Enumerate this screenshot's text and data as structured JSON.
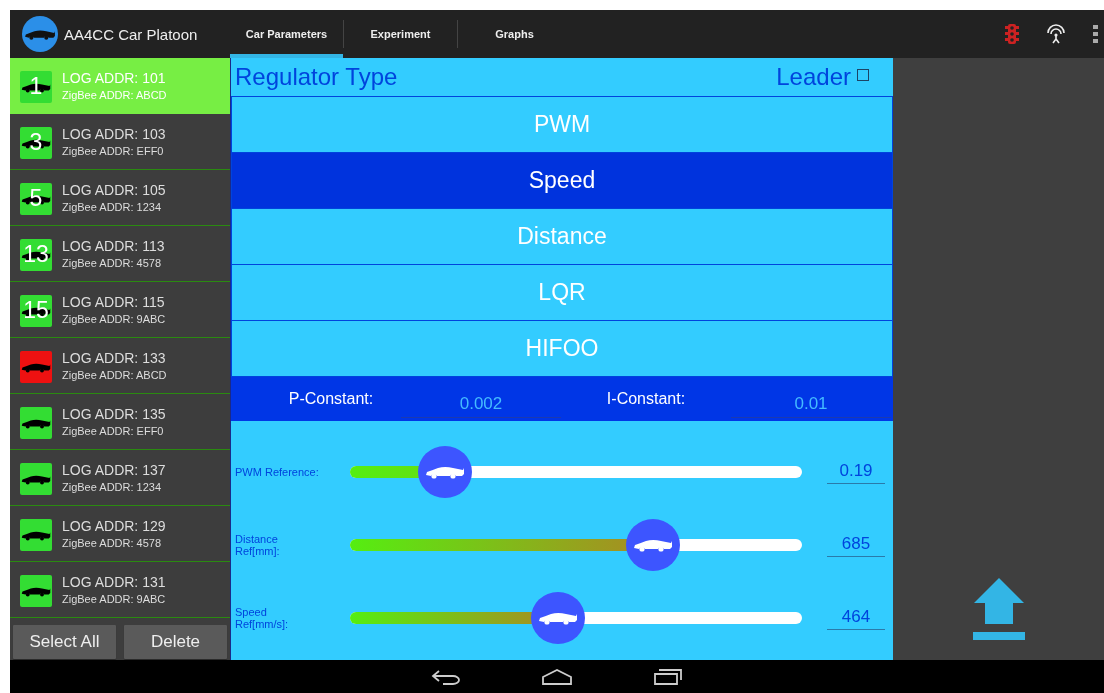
{
  "app_bar": {
    "title": "AA4CC Car Platoon",
    "tabs": [
      {
        "label": "Car Parameters",
        "selected": true
      },
      {
        "label": "Experiment",
        "selected": false
      },
      {
        "label": "Graphs",
        "selected": false
      }
    ]
  },
  "cars": [
    {
      "number": "1",
      "log_addr": "LOG ADDR: 101",
      "zigbee_addr": "ZigBee ADDR: ABCD",
      "color": "#33dd33",
      "selected": true
    },
    {
      "number": "3",
      "log_addr": "LOG ADDR: 103",
      "zigbee_addr": "ZigBee ADDR: EFF0",
      "color": "#33dd33",
      "selected": false
    },
    {
      "number": "5",
      "log_addr": "LOG ADDR: 105",
      "zigbee_addr": "ZigBee ADDR: 1234",
      "color": "#33dd33",
      "selected": false
    },
    {
      "number": "13",
      "log_addr": "LOG ADDR: 113",
      "zigbee_addr": "ZigBee ADDR: 4578",
      "color": "#33dd33",
      "selected": false
    },
    {
      "number": "15",
      "log_addr": "LOG ADDR: 115",
      "zigbee_addr": "ZigBee ADDR: 9ABC",
      "color": "#33dd33",
      "selected": false
    },
    {
      "log_addr": "LOG ADDR: 133",
      "zigbee_addr": "ZigBee ADDR: ABCD",
      "color": "#ee1111",
      "selected": false
    },
    {
      "log_addr": "LOG ADDR: 135",
      "zigbee_addr": "ZigBee ADDR: EFF0",
      "color": "#33dd33",
      "selected": false
    },
    {
      "log_addr": "LOG ADDR: 137",
      "zigbee_addr": "ZigBee ADDR: 1234",
      "color": "#33dd33",
      "selected": false
    },
    {
      "log_addr": "LOG ADDR: 129",
      "zigbee_addr": "ZigBee ADDR: 4578",
      "color": "#33dd33",
      "selected": false
    },
    {
      "log_addr": "LOG ADDR: 131",
      "zigbee_addr": "ZigBee ADDR: 9ABC",
      "color": "#33dd33",
      "selected": false
    }
  ],
  "list_buttons": [
    "Select All",
    "Delete"
  ],
  "regulator": {
    "title": "Regulator Type",
    "leader": {
      "label": "Leader",
      "checked": false
    },
    "options": [
      {
        "label": "PWM",
        "selected": false
      },
      {
        "label": "Speed",
        "selected": true
      },
      {
        "label": "Distance",
        "selected": false
      },
      {
        "label": "LQR",
        "selected": false
      },
      {
        "label": "HIFOO",
        "selected": false
      }
    ]
  },
  "constants": [
    {
      "label": "P-Constant:",
      "value": "0.002"
    },
    {
      "label": "I-Constant:",
      "value": "0.01"
    }
  ],
  "sliders": [
    {
      "label": "PWM Reference:",
      "level": 0.21,
      "value": "0.19"
    },
    {
      "label": "Distance\nRef[mm]:",
      "level": 0.67,
      "value": "685"
    },
    {
      "label": "Speed\nRef[mm/s]:",
      "level": 0.46,
      "value": "464"
    }
  ]
}
